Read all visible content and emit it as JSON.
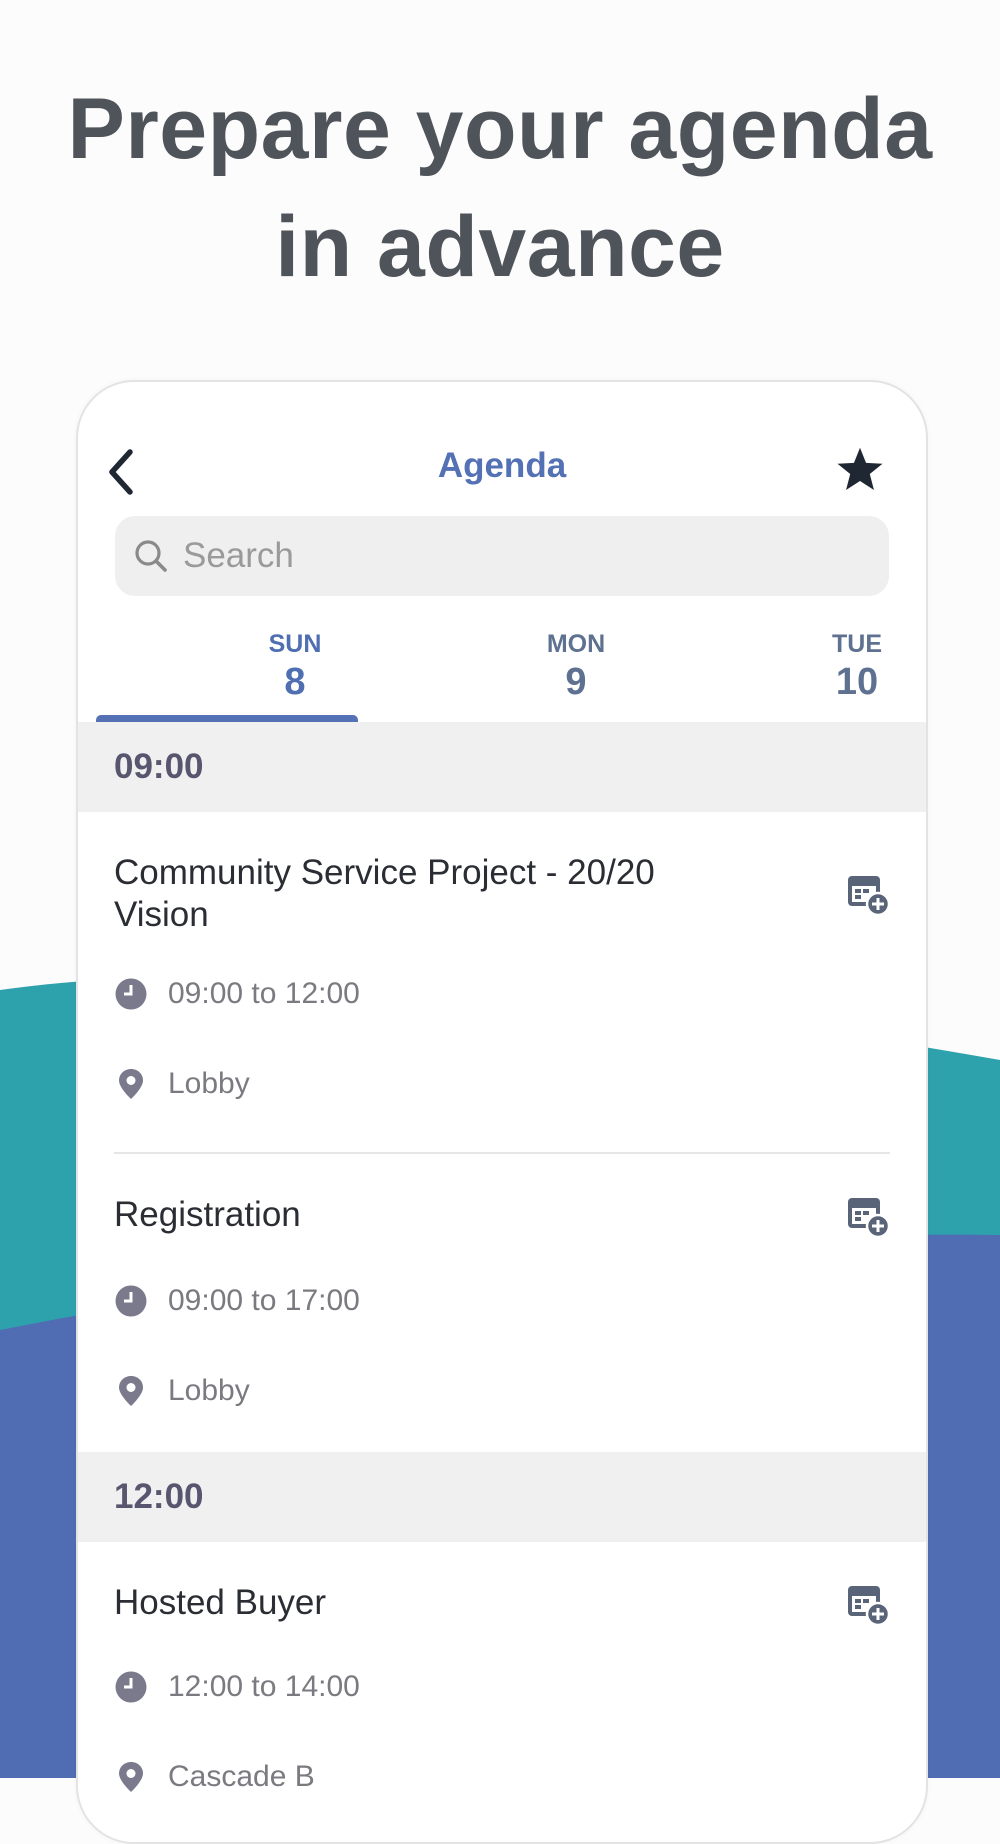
{
  "headline": {
    "line1": "Prepare your agenda",
    "line2": "in advance"
  },
  "colors": {
    "teal": "#2ea2ac",
    "blue": "#506db3",
    "accent": "#5371b4",
    "headline": "#4f535a"
  },
  "app": {
    "title": "Agenda",
    "back_icon": "chevron-left-icon",
    "favorite_icon": "star-icon",
    "search": {
      "placeholder": "Search",
      "value": ""
    },
    "days": [
      {
        "name": "SUN",
        "number": "8",
        "selected": true
      },
      {
        "name": "MON",
        "number": "9",
        "selected": false
      },
      {
        "name": "TUE",
        "number": "10",
        "selected": false
      }
    ],
    "groups": [
      {
        "time": "09:00",
        "sessions": [
          {
            "title": "Community Service Project - 20/20 Vision",
            "time_range": "09:00 to 12:00",
            "location": "Lobby"
          },
          {
            "title": "Registration",
            "time_range": "09:00 to 17:00",
            "location": "Lobby"
          }
        ]
      },
      {
        "time": "12:00",
        "sessions": [
          {
            "title": "Hosted Buyer",
            "time_range": "12:00 to 14:00",
            "location": "Cascade B"
          }
        ]
      }
    ]
  }
}
